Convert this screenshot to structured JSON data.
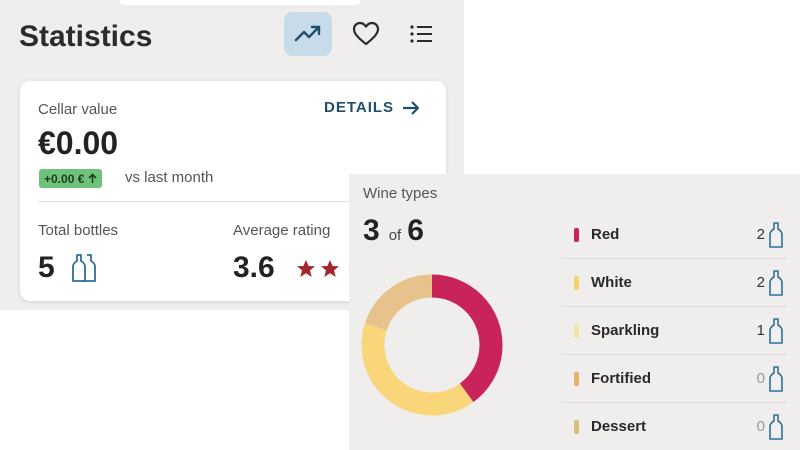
{
  "header": {
    "title": "Statistics",
    "buttons": [
      {
        "icon": "trend-up-icon",
        "active": true
      },
      {
        "icon": "heart-icon",
        "active": false
      },
      {
        "icon": "list-icon",
        "active": false
      }
    ]
  },
  "cellar": {
    "label": "Cellar value",
    "details_label": "DETAILS",
    "value": "€0.00",
    "change": "+0.00 €",
    "change_note": "vs last month"
  },
  "total_bottles": {
    "label": "Total bottles",
    "value": "5"
  },
  "average_rating": {
    "label": "Average rating",
    "value": "3.6",
    "visible_stars": 2
  },
  "wine_types": {
    "label": "Wine types",
    "count": "3",
    "of_label": "of",
    "total": "6",
    "types": [
      {
        "name": "Red",
        "count": "2",
        "color": "#c8245a"
      },
      {
        "name": "White",
        "count": "2",
        "color": "#f5d26e"
      },
      {
        "name": "Sparkling",
        "count": "1",
        "color": "#f3e3a4"
      },
      {
        "name": "Fortified",
        "count": "0",
        "color": "#ebae6b"
      },
      {
        "name": "Dessert",
        "count": "0",
        "color": "#d9c07a"
      }
    ],
    "donut_segments": [
      {
        "name": "Red",
        "value": 2,
        "color": "#c8245a"
      },
      {
        "name": "White",
        "value": 2,
        "color": "#fad67a"
      },
      {
        "name": "Sparkling",
        "value": 1,
        "color": "#e8c28c"
      }
    ]
  },
  "colors": {
    "accent": "#1f4e6a",
    "active_button": "#c7dbe9",
    "positive_badge": "#6fc27a",
    "star": "#a3262e",
    "bottle_icon": "#2d6f96"
  }
}
